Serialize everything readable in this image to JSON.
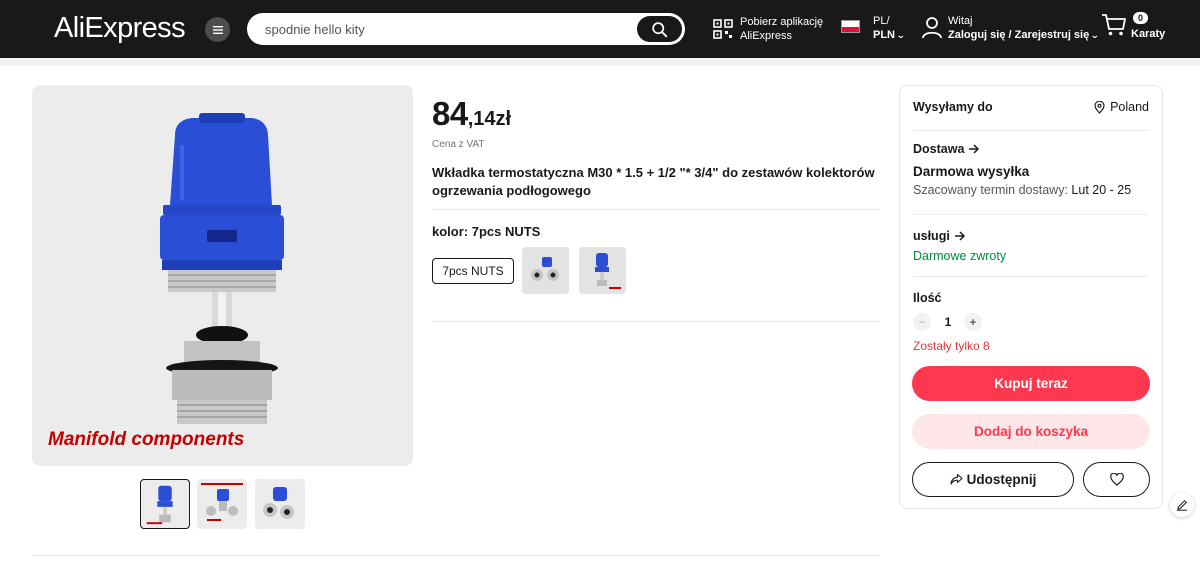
{
  "header": {
    "logo_text": "AliExpress",
    "menu_icon": "menu-icon",
    "search": {
      "value": "spodnie hello kity",
      "button_icon": "search-icon"
    },
    "app_download": {
      "line1": "Pobierz aplikację",
      "line2": "AliExpress",
      "icon": "qr-code-icon"
    },
    "locale": {
      "flag": "poland-flag",
      "lang": "PL/",
      "currency": "PLN"
    },
    "account": {
      "greeting": "Witaj",
      "action": "Zaloguj się / Zarejestruj się",
      "icon": "user-icon"
    },
    "cart": {
      "count": "0",
      "label": "Karaty",
      "icon": "cart-icon"
    }
  },
  "gallery": {
    "main_caption": "Manifold components",
    "thumbnails": [
      "blue-valve-insert",
      "insert-with-nuts",
      "brass-nuts"
    ],
    "selected_index": 0
  },
  "product": {
    "price_int": "84",
    "price_frac": ",14zł",
    "vat_note": "Cena z VAT",
    "title": "Wkładka termostatyczna M30 * 1.5 + 1/2 \"* 3/4\" do zestawów kolektorów ogrzewania podłogowego",
    "color_label": "kolor: 7pcs NUTS",
    "options": [
      {
        "label": "7pcs NUTS",
        "type": "text",
        "selected": true
      },
      {
        "type": "image",
        "icon": "nuts-variant-image"
      },
      {
        "type": "image",
        "icon": "valve-variant-image"
      }
    ]
  },
  "panel": {
    "ship_to_label": "Wysyłamy do",
    "ship_to_country": "Poland",
    "delivery_title": "Dostawa",
    "free_shipping": "Darmowa wysyłka",
    "eta_label": "Szacowany termin dostawy:",
    "eta_value": "Lut 20 - 25",
    "services_title": "usługi",
    "free_returns": "Darmowe zwroty",
    "quantity_title": "Ilość",
    "quantity_value": "1",
    "qty_minus": "−",
    "qty_plus": "+",
    "stock_left": "Zostały tylko 8",
    "buy_now": "Kupuj teraz",
    "add_to_cart": "Dodaj do koszyka",
    "share": "Udostępnij"
  },
  "colors": {
    "header_bg": "#191919",
    "accent_red": "#fd384f",
    "accent_pink": "#ffe7e9",
    "green": "#008a3e",
    "stock_red": "#e0383e"
  }
}
